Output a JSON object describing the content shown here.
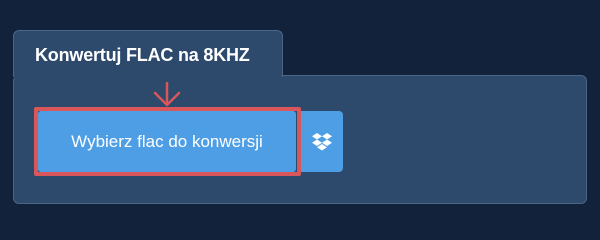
{
  "card": {
    "title": "Konwertuj FLAC na 8KHZ"
  },
  "upload": {
    "button_label": "Wybierz flac do konwersji",
    "dropbox_icon": "dropbox-icon"
  },
  "colors": {
    "background": "#12223a",
    "card": "#2d4a6d",
    "button": "#4e9ee6",
    "highlight": "#d9575b"
  }
}
